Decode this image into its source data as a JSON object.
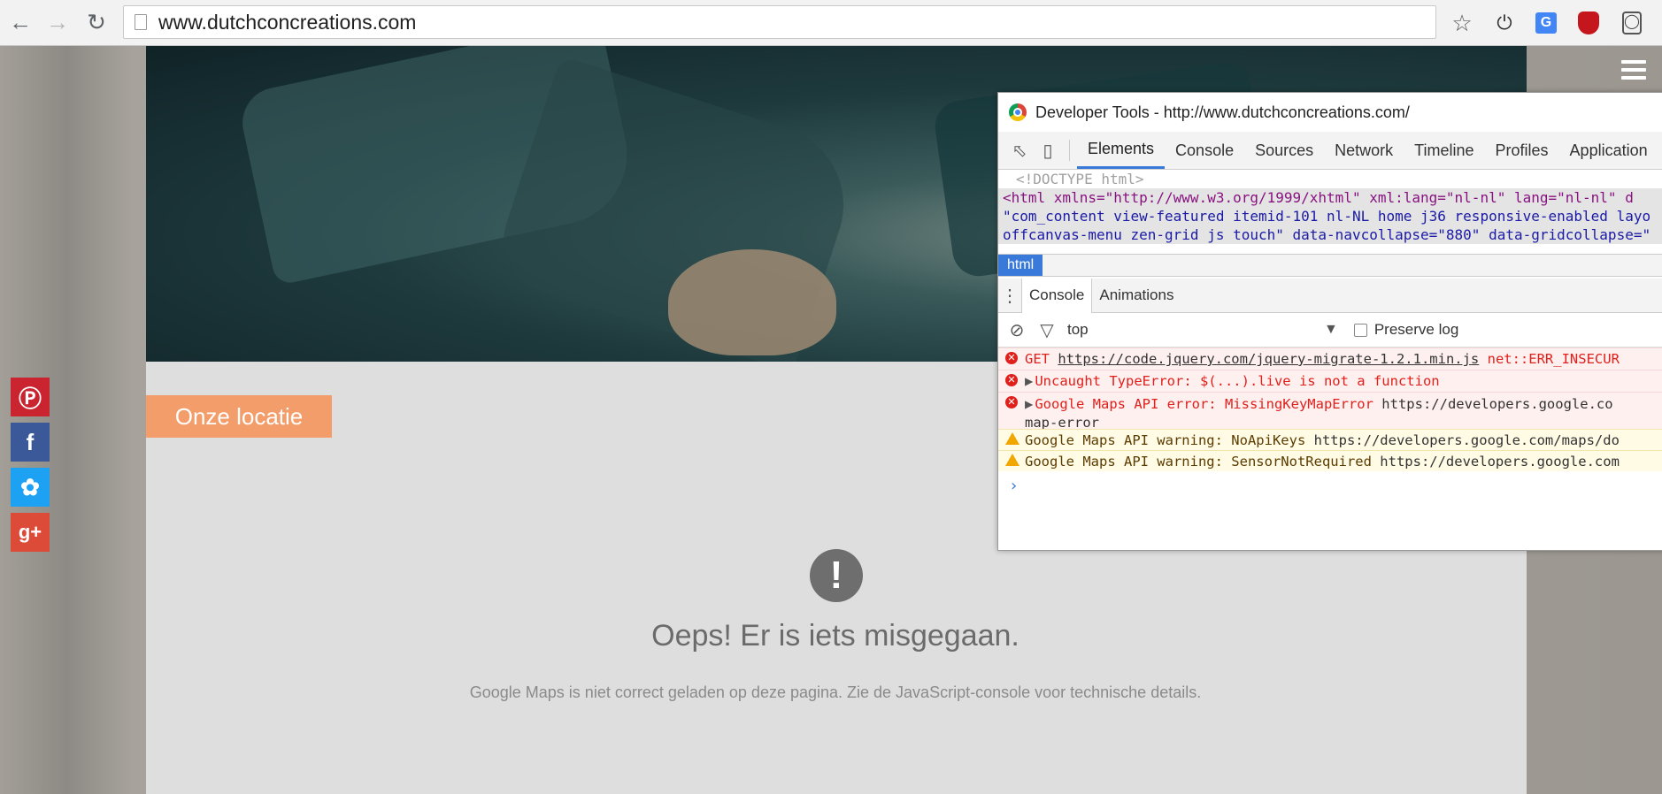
{
  "browser": {
    "url": "www.dutchconcreations.com"
  },
  "page": {
    "location_button": "Onze locatie",
    "error_title": "Oeps! Er is iets misgegaan.",
    "error_description": "Google Maps is niet correct geladen op deze pagina. Zie de JavaScript-console voor technische details.",
    "share_buttons": [
      {
        "name": "pinterest",
        "color": "#c9242f"
      },
      {
        "name": "facebook",
        "color": "#3b5998"
      },
      {
        "name": "twitter",
        "color": "#1da1f2"
      },
      {
        "name": "google-plus",
        "color": "#dc4a38"
      }
    ],
    "accent_color": "#f39d6b"
  },
  "devtools": {
    "title": "Developer Tools - http://www.dutchconcreations.com/",
    "tabs": [
      "Elements",
      "Console",
      "Sources",
      "Network",
      "Timeline",
      "Profiles",
      "Application"
    ],
    "active_tab": "Elements",
    "elements": {
      "doctype": "<!DOCTYPE html>",
      "html_line_1": "<html xmlns=\"http://www.w3.org/1999/xhtml\" xml:lang=\"nl-nl\" lang=\"nl-nl\" d",
      "html_line_2": "\"com_content view-featured itemid-101 nl-NL home j36 responsive-enabled layo",
      "html_line_3": "offcanvas-menu zen-grid js touch\" data-navcollapse=\"880\" data-gridcollapse=\""
    },
    "breadcrumb": "html",
    "drawer_tabs": [
      "Console",
      "Animations"
    ],
    "context": "top",
    "preserve_log_label": "Preserve log",
    "messages": [
      {
        "level": "error",
        "prefix": "GET",
        "link": "https://code.jquery.com/jquery-migrate-1.2.1.min.js",
        "suffix": "net::ERR_INSECUR"
      },
      {
        "level": "error",
        "text": "Uncaught TypeError: $(...).live is not a function"
      },
      {
        "level": "error",
        "text": "Google Maps API error: MissingKeyMapError",
        "detail": "https://developers.google.co",
        "continuation": "map-error"
      },
      {
        "level": "warning",
        "text": "Google Maps API warning: NoApiKeys",
        "detail": "https://developers.google.com/maps/do"
      },
      {
        "level": "warning",
        "text": "Google Maps API warning: SensorNotRequired",
        "detail": "https://developers.google.com"
      }
    ]
  }
}
